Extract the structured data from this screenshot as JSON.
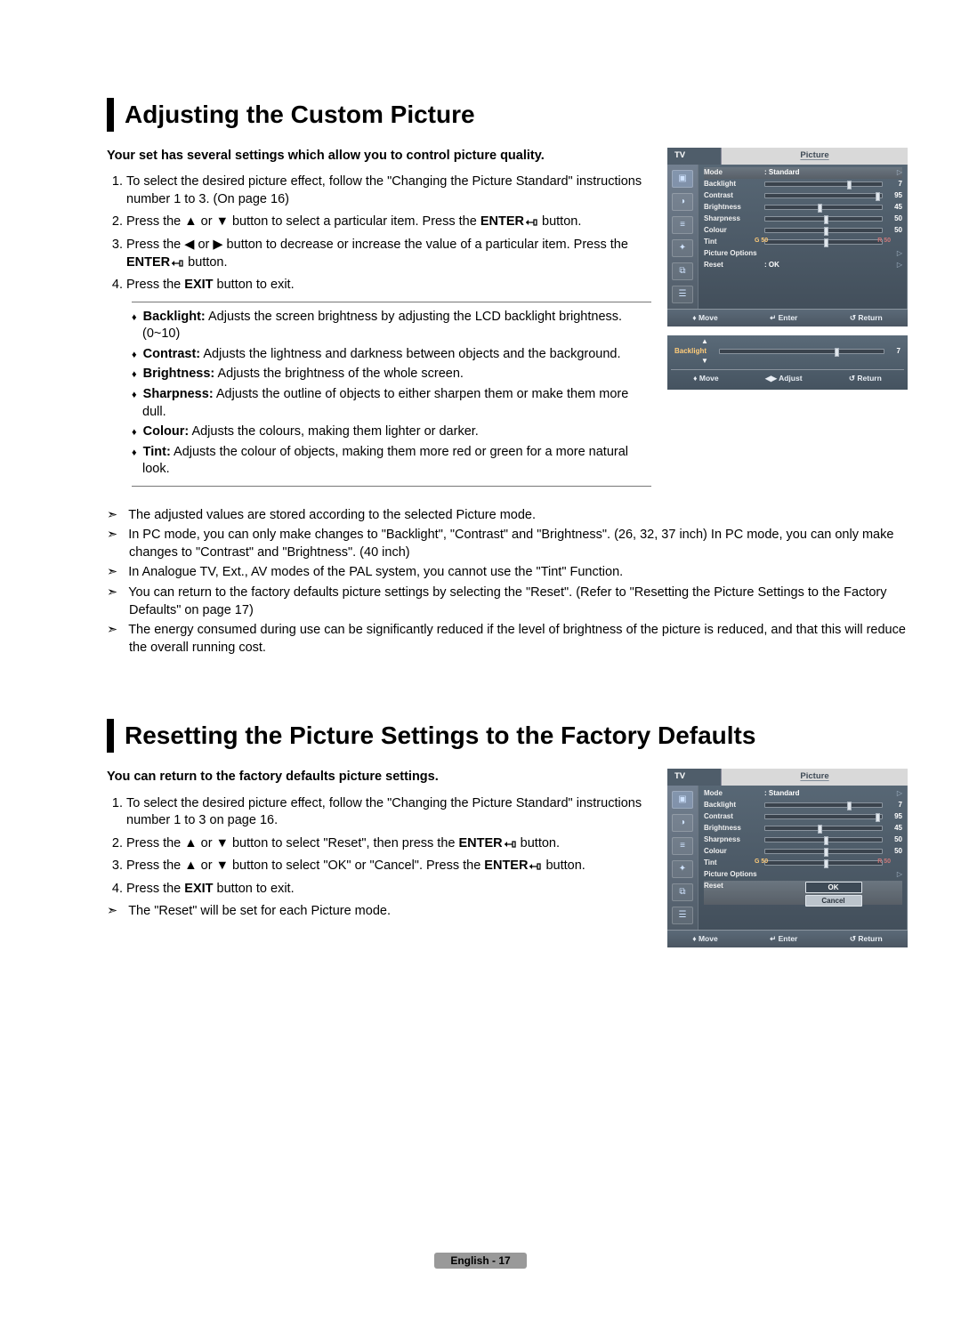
{
  "section1": {
    "title": "Adjusting the Custom Picture",
    "intro": "Your set has several settings which allow you to control picture quality.",
    "steps": [
      "To select the desired picture effect, follow the \"Changing the Picture Standard\" instructions number 1 to 3. (On page 16)",
      "Press the ▲ or ▼ button to select a particular item. Press the ",
      " button.",
      "Press the ◀ or ▶ button to decrease or increase the value of a particular item. Press the ",
      " button.",
      "Press the ",
      " button to exit."
    ],
    "enter_label": "ENTER",
    "exit_label": "EXIT",
    "defs": [
      {
        "term": "Backlight:",
        "desc": " Adjusts the screen brightness by adjusting the LCD backlight brightness. (0~10)"
      },
      {
        "term": "Contrast:",
        "desc": " Adjusts the lightness and darkness between objects and the background."
      },
      {
        "term": "Brightness:",
        "desc": " Adjusts the brightness of the whole screen."
      },
      {
        "term": "Sharpness:",
        "desc": " Adjusts the outline of objects to either sharpen them or make them more dull."
      },
      {
        "term": "Colour:",
        "desc": " Adjusts the colours, making them lighter or darker."
      },
      {
        "term": "Tint:",
        "desc": " Adjusts the colour of objects, making them more red or green for a more natural look."
      }
    ],
    "notes": [
      "The adjusted values are stored according to the selected Picture mode.",
      "In PC mode, you can only make changes to \"Backlight\", \"Contrast\" and \"Brightness\". (26, 32, 37 inch) In PC mode, you can only make changes to \"Contrast\" and \"Brightness\". (40 inch)",
      "In Analogue TV, Ext., AV modes of the PAL system, you cannot use the \"Tint\" Function.",
      "You can return to the factory defaults picture settings by selecting the \"Reset\". (Refer to \"Resetting the Picture Settings to the Factory Defaults\" on page 17)",
      "The energy consumed during use can be significantly reduced if the level of brightness of the picture is reduced, and that this will reduce the overall running cost."
    ]
  },
  "section2": {
    "title": "Resetting the Picture Settings to the Factory Defaults",
    "intro": "You can return to the factory defaults picture settings.",
    "steps_parts": {
      "s1": "To select the desired picture effect, follow the \"Changing the Picture Standard\" instructions number 1 to 3 on page 16.",
      "s2a": "Press the ▲ or ▼ button to select \"Reset\", then press the ",
      "s2b": " button.",
      "s3a": "Press the ▲ or ▼ button to select \"OK\" or \"Cancel\". Press the ",
      "s3b": " button.",
      "s4a": "Press the ",
      "s4b": " button to exit."
    },
    "note": "The \"Reset\" will be set for each Picture mode."
  },
  "osd": {
    "tv": "TV",
    "title": "Picture",
    "items": {
      "mode": {
        "label": "Mode",
        "value": ": Standard"
      },
      "backlight": {
        "label": "Backlight",
        "value": "7",
        "pct": 70
      },
      "contrast": {
        "label": "Contrast",
        "value": "95",
        "pct": 95
      },
      "brightness": {
        "label": "Brightness",
        "value": "45",
        "pct": 45
      },
      "sharpness": {
        "label": "Sharpness",
        "value": "50",
        "pct": 50
      },
      "colour": {
        "label": "Colour",
        "value": "50",
        "pct": 50
      },
      "tint": {
        "label": "Tint",
        "value": "50",
        "g": "G 50",
        "r": "R 50",
        "pct": 50
      },
      "picopt": {
        "label": "Picture Options"
      },
      "reset": {
        "label": "Reset",
        "value": ": OK"
      }
    },
    "footer": {
      "move": "Move",
      "enter": "Enter",
      "return": "Return",
      "adjust": "Adjust"
    },
    "adjbar": {
      "label": "Backlight",
      "value": "7",
      "pct": 70
    },
    "reset_buttons": {
      "ok": "OK",
      "cancel": "Cancel"
    }
  },
  "footer": {
    "lang_page": "English - 17"
  }
}
